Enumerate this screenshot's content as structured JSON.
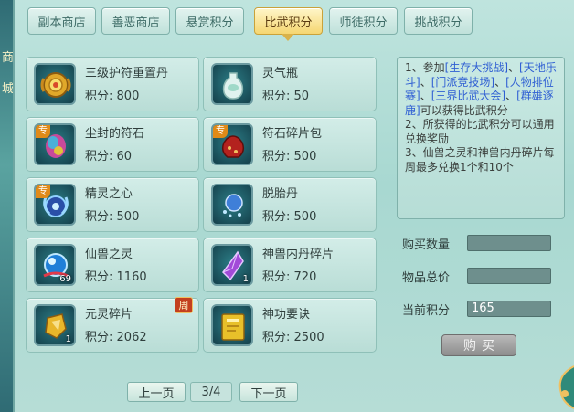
{
  "left_edge": {
    "glyphs": [
      "商",
      "城"
    ]
  },
  "tabs": [
    {
      "label": "副本商店",
      "active": false
    },
    {
      "label": "善恶商店",
      "active": false
    },
    {
      "label": "悬赏积分",
      "active": false
    },
    {
      "label": "比武积分",
      "active": true
    },
    {
      "label": "师徒积分",
      "active": false
    },
    {
      "label": "挑战积分",
      "active": false
    }
  ],
  "score_prefix": "积分:",
  "items": [
    {
      "name": "三级护符重置丹",
      "score": "800",
      "icon": "gold-amulet-icon",
      "count": "",
      "special_tag": "",
      "week": ""
    },
    {
      "name": "灵气瓶",
      "score": "50",
      "icon": "vase-icon",
      "count": "",
      "special_tag": "",
      "week": ""
    },
    {
      "name": "尘封的符石",
      "score": "60",
      "icon": "rune-stone-icon",
      "count": "",
      "special_tag": "专",
      "week": ""
    },
    {
      "name": "符石碎片包",
      "score": "500",
      "icon": "rune-bag-icon",
      "count": "",
      "special_tag": "专",
      "week": ""
    },
    {
      "name": "精灵之心",
      "score": "500",
      "icon": "spirit-heart-icon",
      "count": "",
      "special_tag": "专",
      "week": ""
    },
    {
      "name": "脱胎丹",
      "score": "500",
      "icon": "pill-icon",
      "count": "",
      "special_tag": "",
      "week": ""
    },
    {
      "name": "仙兽之灵",
      "score": "1160",
      "icon": "blue-orb-icon",
      "count": "69",
      "special_tag": "",
      "week": ""
    },
    {
      "name": "神兽内丹碎片",
      "score": "720",
      "icon": "purple-crystal-icon",
      "count": "1",
      "special_tag": "",
      "week": ""
    },
    {
      "name": "元灵碎片",
      "score": "2062",
      "icon": "gold-fragment-icon",
      "count": "1",
      "special_tag": "",
      "week": "周"
    },
    {
      "name": "神功要诀",
      "score": "2500",
      "icon": "yellow-book-icon",
      "count": "",
      "special_tag": "",
      "week": ""
    }
  ],
  "info": {
    "line1_prefix": "1、参加",
    "events": [
      "[生存大挑战]",
      "[天地乐斗]",
      "[门派竞技场]",
      "[人物排位赛]",
      "[三界比武大会]",
      "[群雄逐鹿]"
    ],
    "sep": "、",
    "line1_suffix": "可以获得比武积分",
    "line2": "2、所获得的比武积分可以通用兑换奖励",
    "line3": "3、仙兽之灵和神兽内丹碎片每周最多兑换1个和10个"
  },
  "form": {
    "quantity_label": "购买数量",
    "quantity_value": "",
    "total_label": "物品总价",
    "total_value": "",
    "current_label": "当前积分",
    "current_value": "165",
    "buy_label": "购买"
  },
  "pagination": {
    "prev_label": "上一页",
    "page": "3/4",
    "next_label": "下一页"
  },
  "colors": {
    "active_tab": "#f5d671",
    "highlight_text": "#2f5fd3",
    "panel_bg": "#b6ddd6"
  }
}
